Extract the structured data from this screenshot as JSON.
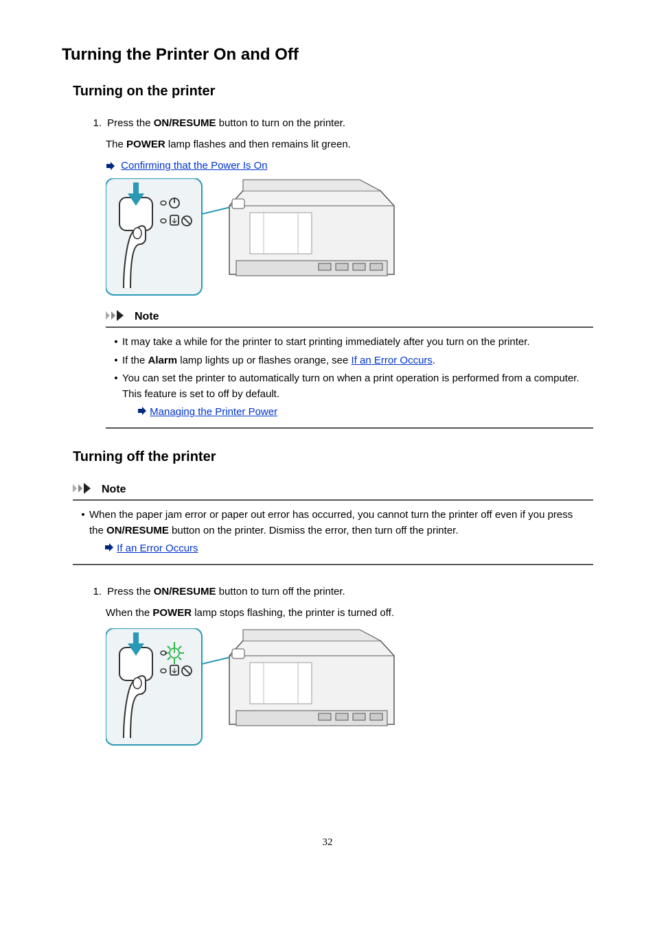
{
  "title": "Turning the Printer On and Off",
  "section_on": {
    "heading": "Turning on the printer",
    "step_number": "1.",
    "step_text_before": "Press the ",
    "step_bold": "ON/RESUME",
    "step_text_after": " button to turn on the printer.",
    "sub_text_before": "The ",
    "sub_bold": "POWER",
    "sub_text_after": " lamp flashes and then remains lit green.",
    "link1": "Confirming that the Power Is On"
  },
  "note1": {
    "label": "Note",
    "item1": "It may take a while for the printer to start printing immediately after you turn on the printer.",
    "item2_before": "If the ",
    "item2_bold": "Alarm",
    "item2_mid": " lamp lights up or flashes orange, see ",
    "item2_link": "If an Error Occurs",
    "item2_after": ".",
    "item3": "You can set the printer to automatically turn on when a print operation is performed from a computer. This feature is set to off by default.",
    "item3_link": "Managing the Printer Power"
  },
  "section_off": {
    "heading": "Turning off the printer"
  },
  "note2": {
    "label": "Note",
    "item1_before": "When the paper jam error or paper out error has occurred, you cannot turn the printer off even if you press the ",
    "item1_bold": "ON/RESUME",
    "item1_after": " button on the printer. Dismiss the error, then turn off the printer.",
    "item1_link": "If an Error Occurs"
  },
  "off_step": {
    "step_number": "1.",
    "step_text_before": "Press the ",
    "step_bold": "ON/RESUME",
    "step_text_after": " button to turn off the printer.",
    "sub_text_before": "When the ",
    "sub_bold": "POWER",
    "sub_text_after": " lamp stops flashing, the printer is turned off."
  },
  "page_number": "32"
}
